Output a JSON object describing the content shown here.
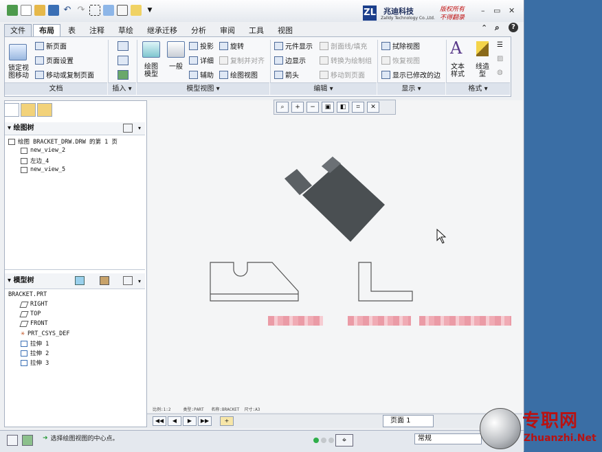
{
  "window": {
    "logo": {
      "mark": "ZL",
      "cn": "兆迪科技",
      "en": "Zalldy Technology Co.,Ltd.",
      "slogan1": "版权所有",
      "slogan2": "不得翻录"
    },
    "controls": {
      "minimize": "–",
      "restore": "▭",
      "close": "✕"
    }
  },
  "tabs": [
    {
      "label": "文件",
      "kind": "file"
    },
    {
      "label": "布局",
      "kind": "active"
    },
    {
      "label": "表"
    },
    {
      "label": "注释"
    },
    {
      "label": "草绘"
    },
    {
      "label": "继承迁移"
    },
    {
      "label": "分析"
    },
    {
      "label": "审阅"
    },
    {
      "label": "工具"
    },
    {
      "label": "视图"
    }
  ],
  "ribbon": {
    "doc": {
      "lock_move": "锁定视\n图移动",
      "new_page": "新页面",
      "page_setup": "页面设置",
      "move_copy_page": "移动或复制页面",
      "group": "文档"
    },
    "insert": {
      "group": "插入"
    },
    "model_view": {
      "drawing_model": "绘图\n模型",
      "general": "一般",
      "projection": "投影",
      "detail": "详细",
      "auxiliary": "辅助",
      "rotate": "旋转",
      "copy_align": "复制并对齐",
      "drawing_view": "绘图视图",
      "group": "模型视图"
    },
    "edit": {
      "component_display": "元件显示",
      "edge_display": "边显示",
      "arrow": "箭头",
      "section_fill": "剖面线/填充",
      "convert_group": "转换为绘制组",
      "move_to_page": "移动到页面",
      "group": "编辑"
    },
    "display": {
      "erase_view": "拭除视图",
      "restore_view": "恢复视图",
      "show_modified_edges": "显示已修改的边",
      "group": "显示"
    },
    "format": {
      "text_style": "文本\n样式",
      "line_style": "线造\n型",
      "group": "格式"
    }
  },
  "drawing_tree": {
    "title": "绘图树",
    "items": [
      "绘图 BRACKET_DRW.DRW 的第 1 页",
      "new_view_2",
      "左边_4",
      "new_view_5"
    ]
  },
  "model_tree": {
    "title": "模型树",
    "items": [
      "BRACKET.PRT",
      "RIGHT",
      "TOP",
      "FRONT",
      "PRT_CSYS_DEF",
      "拉伸 1",
      "拉伸 2",
      "拉伸 3"
    ]
  },
  "canvas": {
    "mini_status": "比例:1:2     类型:PART   名称:BRACKET  尺寸:A3"
  },
  "page_bar": {
    "page_label": "页面 1"
  },
  "status": {
    "message": "选择绘图视图的中心点。",
    "filter_value": "常规"
  },
  "watermark": {
    "cn": "专职网",
    "en": "Zhuanzhi.Net"
  },
  "colors": {
    "accent": "#3a6ea5",
    "shaded_part": "#4a4f52",
    "watermark": "#b81212"
  }
}
